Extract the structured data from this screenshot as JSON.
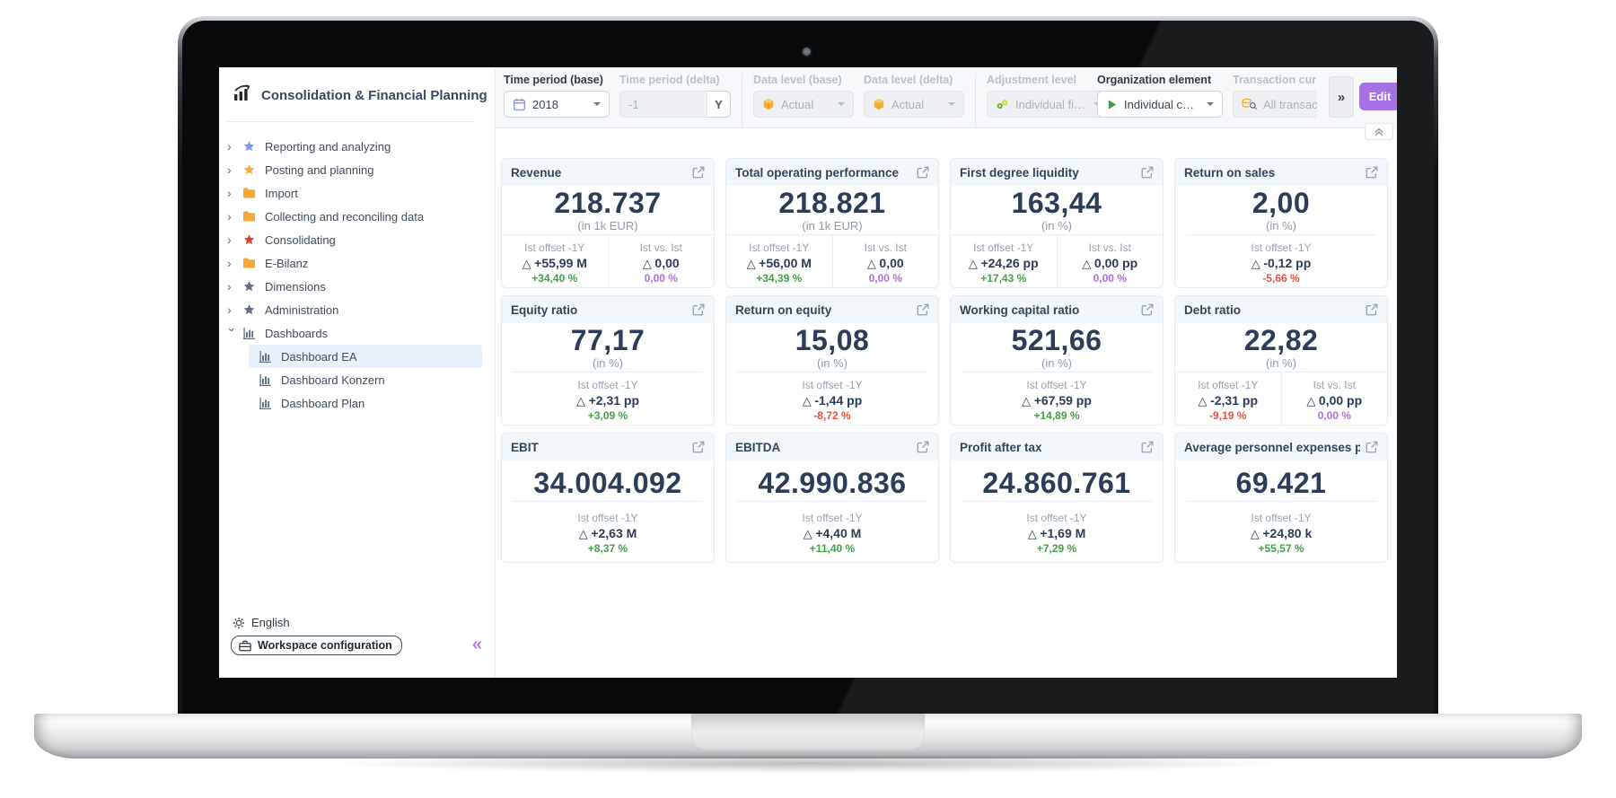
{
  "app": {
    "title": "Consolidation & Financial Planning"
  },
  "sidebar": {
    "items": [
      {
        "label": "Reporting and analyzing",
        "icon": "star",
        "color": "#7f97f2",
        "chevron": "right"
      },
      {
        "label": "Posting and planning",
        "icon": "star",
        "color": "#f3a93a",
        "chevron": "right"
      },
      {
        "label": "Import",
        "icon": "folder",
        "color": "#f3a93a",
        "chevron": "right"
      },
      {
        "label": "Collecting and reconciling data",
        "icon": "folder",
        "color": "#f3a93a",
        "chevron": "right"
      },
      {
        "label": "Consolidating",
        "icon": "star",
        "color": "#e04330",
        "chevron": "right"
      },
      {
        "label": "E-Bilanz",
        "icon": "folder",
        "color": "#f3a93a",
        "chevron": "right"
      },
      {
        "label": "Dimensions",
        "icon": "star",
        "color": "#5d7089",
        "chevron": "right"
      },
      {
        "label": "Administration",
        "icon": "star",
        "color": "#5d7089",
        "chevron": "right"
      },
      {
        "label": "Dashboards",
        "icon": "dashboard",
        "color": "#5d7089",
        "chevron": "down"
      },
      {
        "label": "Dashboard EA",
        "icon": "dashboard",
        "color": "#5d7089",
        "child": true,
        "selected": true
      },
      {
        "label": "Dashboard Konzern",
        "icon": "dashboard",
        "color": "#5d7089",
        "child": true
      },
      {
        "label": "Dashboard Plan",
        "icon": "dashboard",
        "color": "#5d7089",
        "child": true
      }
    ],
    "footer": {
      "language": "English",
      "workspace_button": "Workspace configuration",
      "collapse_icon": "«"
    }
  },
  "toolbar": {
    "fields": [
      {
        "label": "Time period (base)",
        "value": "2018",
        "icon": "calendar",
        "chevron": true,
        "disabled": false
      },
      {
        "label": "Time period (delta)",
        "value": "-1",
        "suffix": "Y",
        "chevron": false,
        "disabled": true,
        "group_end": true
      },
      {
        "label": "Data level (base)",
        "value": "Actual",
        "icon": "cube",
        "chevron": true,
        "disabled": true
      },
      {
        "label": "Data level (delta)",
        "value": "Actual",
        "icon": "cube",
        "chevron": true,
        "disabled": true,
        "group_end": true
      },
      {
        "label": "Adjustment level",
        "value": "Individual fi…",
        "icon": "adjust",
        "chevron": true,
        "disabled": true
      },
      {
        "label": "Organization element",
        "value": "Individual c…",
        "icon": "play",
        "chevron": true,
        "disabled": false
      },
      {
        "label": "Transaction curr",
        "value": "All transac",
        "icon": "coins",
        "chevron": false,
        "disabled": true
      }
    ],
    "more_button": "»",
    "edit_button": "Edit"
  },
  "dashboard": {
    "cards": [
      {
        "title": "Revenue",
        "value": "218.737",
        "unit": "(in 1k EUR)",
        "deltas": [
          {
            "label": "Ist offset -1Y",
            "value": "+55,99 M",
            "pct": "+34,40 %",
            "color": "#43a047"
          },
          {
            "label": "Ist vs. Ist",
            "value": "0,00",
            "pct": "0,00 %",
            "color": "#b36ae2"
          }
        ]
      },
      {
        "title": "Total operating performance",
        "value": "218.821",
        "unit": "(in 1k EUR)",
        "deltas": [
          {
            "label": "Ist offset -1Y",
            "value": "+56,00 M",
            "pct": "+34,39 %",
            "color": "#43a047"
          },
          {
            "label": "Ist vs. Ist",
            "value": "0,00",
            "pct": "0,00 %",
            "color": "#b36ae2"
          }
        ]
      },
      {
        "title": "First degree liquidity",
        "value": "163,44",
        "unit": "(in %)",
        "deltas": [
          {
            "label": "Ist offset -1Y",
            "value": "+24,26 pp",
            "pct": "+17,43 %",
            "color": "#43a047"
          },
          {
            "label": "Ist vs. Ist",
            "value": "0,00 pp",
            "pct": "0,00 %",
            "color": "#b36ae2"
          }
        ]
      },
      {
        "title": "Return on sales",
        "value": "2,00",
        "unit": "(in %)",
        "deltas": [
          {
            "label": "Ist offset -1Y",
            "value": "-0,12 pp",
            "pct": "-5,66 %",
            "color": "#e2513f"
          }
        ]
      },
      {
        "title": "Equity ratio",
        "value": "77,17",
        "unit": "(in %)",
        "deltas": [
          {
            "label": "Ist offset -1Y",
            "value": "+2,31 pp",
            "pct": "+3,09 %",
            "color": "#43a047"
          }
        ]
      },
      {
        "title": "Return on equity",
        "value": "15,08",
        "unit": "(in %)",
        "deltas": [
          {
            "label": "Ist offset -1Y",
            "value": "-1,44 pp",
            "pct": "-8,72 %",
            "color": "#e2513f"
          }
        ]
      },
      {
        "title": "Working capital ratio",
        "value": "521,66",
        "unit": "(in %)",
        "deltas": [
          {
            "label": "Ist offset -1Y",
            "value": "+67,59 pp",
            "pct": "+14,89 %",
            "color": "#43a047"
          }
        ]
      },
      {
        "title": "Debt ratio",
        "value": "22,82",
        "unit": "(in %)",
        "deltas": [
          {
            "label": "Ist offset -1Y",
            "value": "-2,31 pp",
            "pct": "-9,19 %",
            "color": "#e2513f"
          },
          {
            "label": "Ist vs. Ist",
            "value": "0,00 pp",
            "pct": "0,00 %",
            "color": "#b36ae2"
          }
        ]
      },
      {
        "title": "EBIT",
        "value": "34.004.092",
        "unit": null,
        "deltas": [
          {
            "label": "Ist offset -1Y",
            "value": "+2,63 M",
            "pct": "+8,37 %",
            "color": "#43a047"
          }
        ]
      },
      {
        "title": "EBITDA",
        "value": "42.990.836",
        "unit": null,
        "deltas": [
          {
            "label": "Ist offset -1Y",
            "value": "+4,40 M",
            "pct": "+11,40 %",
            "color": "#43a047"
          }
        ]
      },
      {
        "title": "Profit after tax",
        "value": "24.860.761",
        "unit": null,
        "deltas": [
          {
            "label": "Ist offset -1Y",
            "value": "+1,69 M",
            "pct": "+7,29 %",
            "color": "#43a047"
          }
        ]
      },
      {
        "title": "Average personnel expenses p…",
        "value": "69.421",
        "unit": null,
        "deltas": [
          {
            "label": "Ist offset -1Y",
            "value": "+24,80 k",
            "pct": "+55,57 %",
            "color": "#43a047"
          }
        ]
      }
    ]
  },
  "colors": {
    "accent_purple": "#a571e3",
    "positive": "#43a047",
    "negative": "#e2513f",
    "neutral_purple": "#b36ae2"
  }
}
